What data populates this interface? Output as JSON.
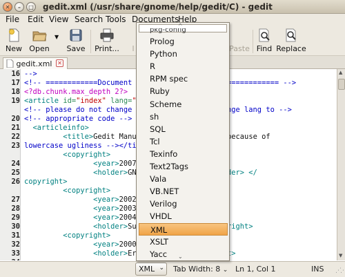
{
  "window": {
    "title": "gedit.xml (/usr/share/gnome/help/gedit/C) - gedit"
  },
  "menubar": {
    "items": [
      "File",
      "Edit",
      "View",
      "Search",
      "Tools",
      "Documents",
      "Help"
    ]
  },
  "toolbar": {
    "buttons": [
      {
        "label": "New",
        "icon": "new-document-icon",
        "enabled": true
      },
      {
        "label": "Open",
        "icon": "open-folder-icon",
        "enabled": true
      },
      {
        "label": "Save",
        "icon": "save-icon",
        "enabled": true
      },
      {
        "label": "Print...",
        "icon": "printer-icon",
        "enabled": true
      },
      {
        "label": "Paste",
        "icon": "paste-icon",
        "enabled": false
      },
      {
        "label": "Find",
        "icon": "find-icon",
        "enabled": true
      },
      {
        "label": "Replace",
        "icon": "replace-icon",
        "enabled": true
      }
    ],
    "clipped_label": "l"
  },
  "tab": {
    "label": "gedit.xml"
  },
  "editor": {
    "line_numbers": [
      "16",
      "17",
      "18",
      "19",
      "",
      "20",
      "21",
      "22",
      "23",
      "",
      "24",
      "25",
      "26",
      "",
      "27",
      "28",
      "29",
      "30",
      "31",
      "32",
      "33",
      "34",
      ""
    ],
    "lines": [
      [
        {
          "t": "-->",
          "c": "#0000c8"
        }
      ],
      [
        {
          "t": "<!-- ============Document ",
          "c": "#0000c8"
        },
        {
          "t": "                 ================ -->",
          "c": "#0000c8"
        }
      ],
      [
        {
          "t": "<?db.chunk.max_depth 2?>",
          "c": "#c000c0"
        }
      ],
      [
        {
          "t": "<article ",
          "c": "#008080"
        },
        {
          "t": "id=",
          "c": "#2e8b57"
        },
        {
          "t": "\"index\"",
          "c": "#c00000"
        },
        {
          "t": " lang=",
          "c": "#2e8b57"
        },
        {
          "t": "\"e",
          "c": "#c00000"
        }
      ],
      [
        {
          "t": "<!-- please do not change t",
          "c": "#0000c8"
        },
        {
          "t": "              s, change lang to -->",
          "c": "#0000c8"
        }
      ],
      [
        {
          "t": "<!-- appropriate code -->",
          "c": "#0000c8"
        }
      ],
      [
        {
          "t": "  <articleinfo>",
          "c": "#008080"
        }
      ],
      [
        {
          "t": "         <title>",
          "c": "#008080"
        },
        {
          "t": "Gedit Manua",
          "c": "#111"
        },
        {
          "t": "               city because of",
          "c": "#111"
        }
      ],
      [
        {
          "t": "lowercase ugliness --></ti",
          "c": "#0000c8"
        }
      ],
      [
        {
          "t": "         <copyright>",
          "c": "#008080"
        }
      ],
      [
        {
          "t": "                <year>",
          "c": "#008080"
        },
        {
          "t": "2007-",
          "c": "#111"
        }
      ],
      [
        {
          "t": "                <holder>",
          "c": "#008080"
        },
        {
          "t": "GN",
          "c": "#111"
        },
        {
          "t": "               t",
          "c": "#111"
        },
        {
          "t": "</holder> </",
          "c": "#008080"
        }
      ],
      [
        {
          "t": "copyright>",
          "c": "#008080"
        }
      ],
      [
        {
          "t": "         <copyright>",
          "c": "#008080"
        }
      ],
      [
        {
          "t": "                <year>",
          "c": "#008080"
        },
        {
          "t": "2002-",
          "c": "#111"
        }
      ],
      [
        {
          "t": "                <year>",
          "c": "#008080"
        },
        {
          "t": "2003-",
          "c": "#111"
        }
      ],
      [
        {
          "t": "                <year>",
          "c": "#008080"
        },
        {
          "t": "2004-",
          "c": "#111"
        }
      ],
      [
        {
          "t": "                <holder>",
          "c": "#008080"
        },
        {
          "t": "Sun",
          "c": "#111"
        },
        {
          "t": "              </copyright>",
          "c": "#008080"
        }
      ],
      [
        {
          "t": "         <copyright>",
          "c": "#008080"
        }
      ],
      [
        {
          "t": "                <year>",
          "c": "#008080"
        },
        {
          "t": "2000-",
          "c": "#111"
        }
      ],
      [
        {
          "t": "                <holder>",
          "c": "#008080"
        },
        {
          "t": "Eri",
          "c": "#111"
        },
        {
          "t": "             opyright>",
          "c": "#008080"
        }
      ],
      [
        {
          "t": "",
          "c": "#111"
        }
      ]
    ]
  },
  "language_popup": {
    "clipped_top": "pkg-config",
    "items": [
      "Prolog",
      "Python",
      "R",
      "RPM spec",
      "Ruby",
      "Scheme",
      "sh",
      "SQL",
      "Tcl",
      "Texinfo",
      "Text2Tags",
      "Vala",
      "VB.NET",
      "Verilog",
      "VHDL",
      "XML",
      "XSLT",
      "Yacc"
    ],
    "selected": "XML"
  },
  "statusbar": {
    "language": "XML",
    "tab_width": "Tab Width: 8",
    "position": "Ln 1, Col 1",
    "mode": "INS"
  }
}
